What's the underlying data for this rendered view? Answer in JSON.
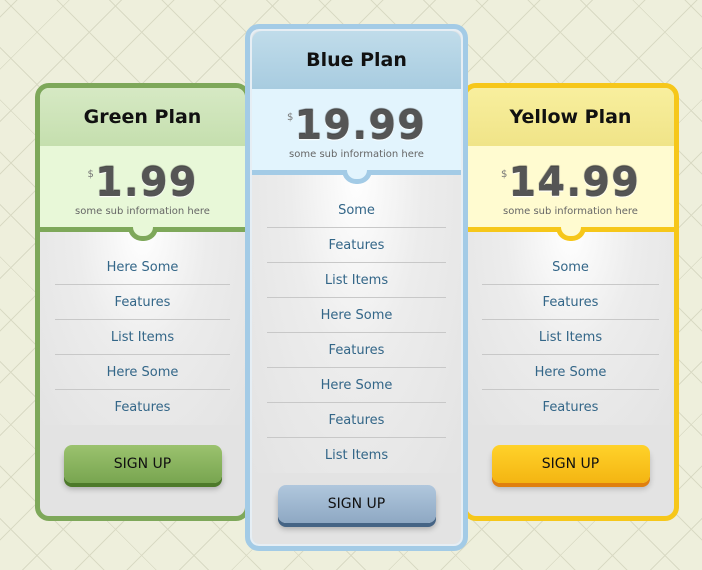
{
  "plans": [
    {
      "id": "green",
      "name": "Green Plan",
      "currency": "$",
      "price": "1.99",
      "sub_info": "some sub information here",
      "features": [
        "Here Some",
        "Features",
        "List Items",
        "Here Some",
        "Features"
      ],
      "button_label": "SIGN UP",
      "accent_color": "#7ea85a"
    },
    {
      "id": "blue",
      "name": "Blue Plan",
      "currency": "$",
      "price": "19.99",
      "sub_info": "some sub information here",
      "features": [
        "Some",
        "Features",
        "List Items",
        "Here Some",
        "Features",
        "Here Some",
        "Features",
        "List Items"
      ],
      "button_label": "SIGN UP",
      "accent_color": "#a3cbe6"
    },
    {
      "id": "yellow",
      "name": "Yellow Plan",
      "currency": "$",
      "price": "14.99",
      "sub_info": "some sub information here",
      "features": [
        "Some",
        "Features",
        "List Items",
        "Here Some",
        "Features"
      ],
      "button_label": "SIGN UP",
      "accent_color": "#f6c71a"
    }
  ]
}
